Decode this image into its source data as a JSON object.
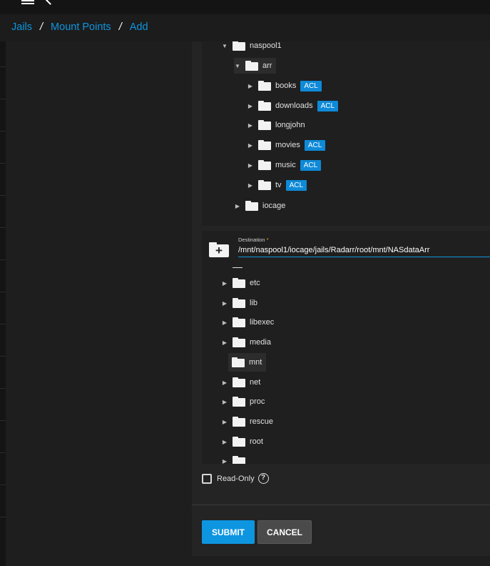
{
  "breadcrumb": [
    "Jails",
    "Mount Points",
    "Add"
  ],
  "source_tree": [
    {
      "label": "naspool1",
      "expanded": true,
      "acl": false
    },
    {
      "label": "arr",
      "expanded": true,
      "acl": false
    },
    {
      "label": "books",
      "expanded": false,
      "acl": true
    },
    {
      "label": "downloads",
      "expanded": false,
      "acl": true
    },
    {
      "label": "longjohn",
      "expanded": false,
      "acl": false
    },
    {
      "label": "movies",
      "expanded": false,
      "acl": true
    },
    {
      "label": "music",
      "expanded": false,
      "acl": true
    },
    {
      "label": "tv",
      "expanded": false,
      "acl": true
    },
    {
      "label": "iocage",
      "expanded": false,
      "acl": false
    }
  ],
  "acl_badge": "ACL",
  "destination": {
    "label": "Destination",
    "required_mark": "*",
    "value": "/mnt/naspool1/iocage/jails/Radarr/root/mnt/NASdataArr"
  },
  "dest_tree": [
    {
      "label": "etc"
    },
    {
      "label": "lib"
    },
    {
      "label": "libexec"
    },
    {
      "label": "media"
    },
    {
      "label": "mnt"
    },
    {
      "label": "net"
    },
    {
      "label": "proc"
    },
    {
      "label": "rescue"
    },
    {
      "label": "root"
    }
  ],
  "readonly": {
    "label": "Read-Only",
    "checked": false
  },
  "buttons": {
    "submit": "SUBMIT",
    "cancel": "CANCEL"
  },
  "colors": {
    "accent": "#0e95e0",
    "acl_badge": "#0e8ad8"
  }
}
